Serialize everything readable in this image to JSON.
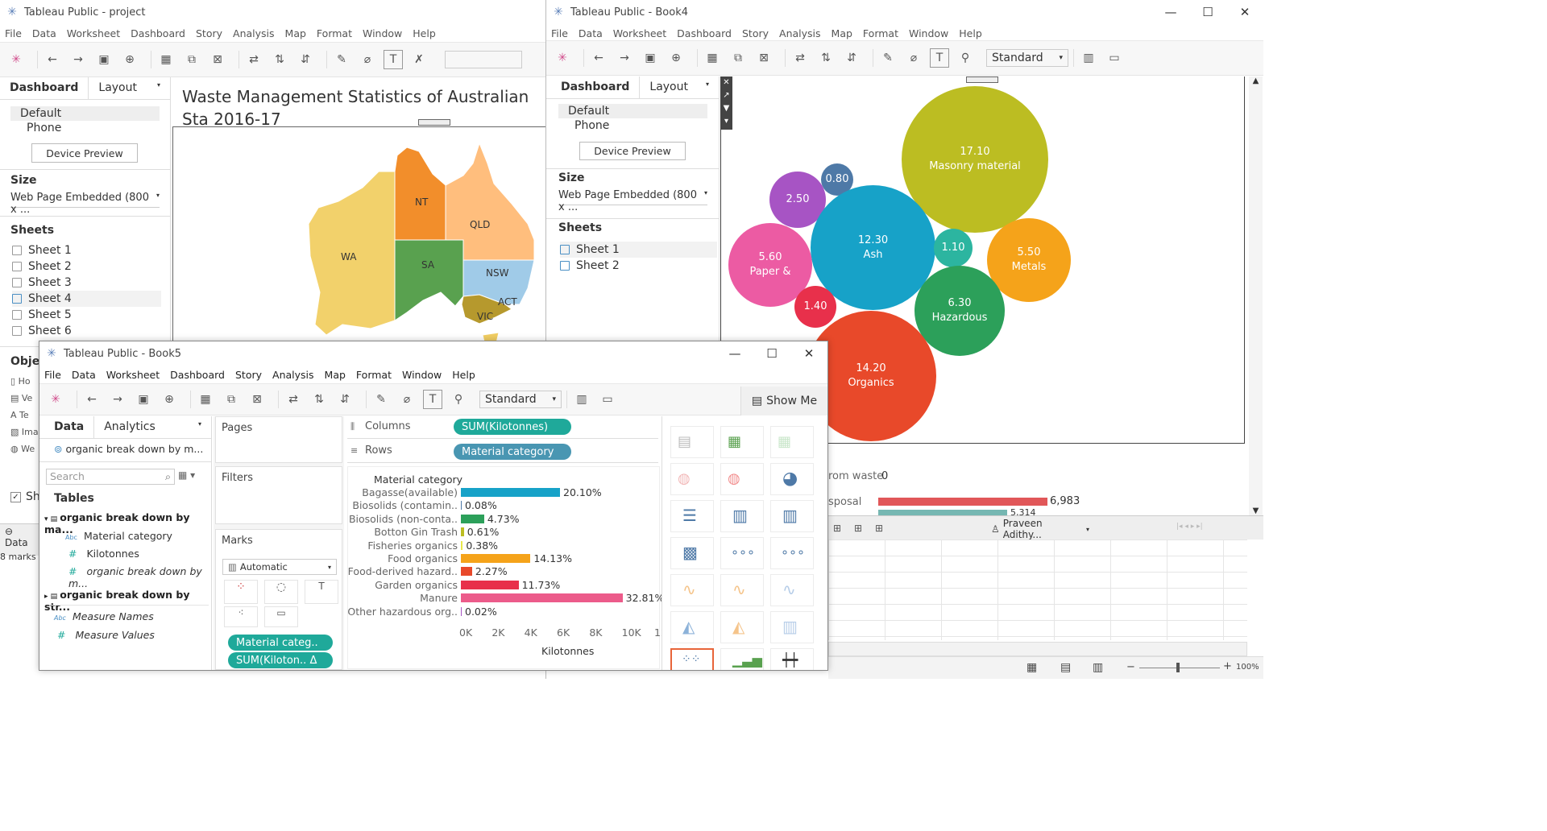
{
  "win_project": {
    "title": "Tableau Public - project",
    "menu": [
      "File",
      "Data",
      "Worksheet",
      "Dashboard",
      "Story",
      "Analysis",
      "Map",
      "Format",
      "Window",
      "Help"
    ],
    "tabs": {
      "dashboard": "Dashboard",
      "layout": "Layout"
    },
    "device_options": [
      "Default",
      "Phone"
    ],
    "device_preview": "Device Preview",
    "size_label": "Size",
    "size_value": "Web Page Embedded (800 x ...",
    "sheets_label": "Sheets",
    "sheets": [
      "Sheet 1",
      "Sheet 2",
      "Sheet 3",
      "Sheet 4",
      "Sheet 5",
      "Sheet 6"
    ],
    "objects_label": "Obje",
    "objects": [
      "Ho",
      "Ve",
      "Te",
      "Ima",
      "We"
    ],
    "show_title_label": "Sh",
    "dashboard_title": "Waste Management Statistics of Australian Sta 2016-17",
    "map_states": [
      "WA",
      "NT",
      "SA",
      "QLD",
      "NSW",
      "VIC",
      "ACT"
    ],
    "status_tab": "Data",
    "status_marks": "8 marks"
  },
  "win_book4": {
    "title": "Tableau Public - Book4",
    "menu": [
      "File",
      "Data",
      "Worksheet",
      "Dashboard",
      "Story",
      "Analysis",
      "Map",
      "Format",
      "Window",
      "Help"
    ],
    "standard": "Standard",
    "tabs": {
      "dashboard": "Dashboard",
      "layout": "Layout"
    },
    "device_options": [
      "Default",
      "Phone"
    ],
    "device_preview": "Device Preview",
    "size_label": "Size",
    "size_value": "Web Page Embedded (800 x ...",
    "sheets_label": "Sheets",
    "sheets": [
      "Sheet 1",
      "Sheet 2"
    ],
    "bubbles": [
      {
        "value": "17.10",
        "label": "Masonry material",
        "color": "#bcbd22"
      },
      {
        "value": "0.80",
        "label": "",
        "color": "#4e79a7"
      },
      {
        "value": "2.50",
        "label": "",
        "color": "#a754c4"
      },
      {
        "value": "12.30",
        "label": "Ash",
        "color": "#17a2c8"
      },
      {
        "value": "1.10",
        "label": "",
        "color": "#2cb5a0"
      },
      {
        "value": "5.50",
        "label": "Metals",
        "color": "#f5a31a"
      },
      {
        "value": "5.60",
        "label": "Paper &",
        "color": "#ec5ba3"
      },
      {
        "value": "6.30",
        "label": "Hazardous",
        "color": "#2ca05a"
      },
      {
        "value": "1.40",
        "label": "",
        "color": "#e8304b"
      },
      {
        "value": "14.20",
        "label": "Organics",
        "color": "#e8492a"
      }
    ],
    "under_label_1": "rom waste",
    "under_value_1": "0",
    "under_label_2": "sposal",
    "under_value_2": "6,983",
    "under_value_3": "5,314",
    "user": "Praveen Adithy...",
    "zoom": "100%"
  },
  "win_book5": {
    "title": "Tableau Public - Book5",
    "menu": [
      "File",
      "Data",
      "Worksheet",
      "Dashboard",
      "Story",
      "Analysis",
      "Map",
      "Format",
      "Window",
      "Help"
    ],
    "standard": "Standard",
    "show_me": "Show Me",
    "tabs": {
      "data": "Data",
      "analytics": "Analytics"
    },
    "datasource": "organic break down by m...",
    "search_placeholder": "Search",
    "tables_label": "Tables",
    "table1": "organic break down by ma...",
    "fields": [
      "Material category",
      "Kilotonnes",
      "organic break down by m..."
    ],
    "table2": "organic break down by str...",
    "measure_names": "Measure Names",
    "measure_values": "Measure Values",
    "pages_label": "Pages",
    "filters_label": "Filters",
    "marks_label": "Marks",
    "marks_type": "Automatic",
    "mark_pill_1": "Material categ..",
    "mark_pill_2": "SUM(Kiloton.. Δ",
    "columns_label": "Columns",
    "rows_label": "Rows",
    "columns_pill": "SUM(Kilotonnes)",
    "rows_pill": "Material category"
  },
  "chart_data": {
    "type": "bar",
    "title": "",
    "ylabel": "Material category",
    "xlabel": "Kilotonnes",
    "xlim": [
      0,
      12000
    ],
    "xticks": [
      "0K",
      "2K",
      "4K",
      "6K",
      "8K",
      "10K",
      "12"
    ],
    "categories": [
      "Bagasse(available)",
      "Biosolids (contamin..",
      "Biosolids (non-conta..",
      "Botton Gin Trash",
      "Fisheries organics",
      "Food organics",
      "Food-derived hazard..",
      "Garden organics",
      "Manure",
      "Other hazardous org.."
    ],
    "values": [
      6100,
      25,
      1430,
      185,
      115,
      4280,
      690,
      3550,
      9950,
      6
    ],
    "labels": [
      "20.10%",
      "0.08%",
      "4.73%",
      "0.61%",
      "0.38%",
      "14.13%",
      "2.27%",
      "11.73%",
      "32.81%",
      "0.02%"
    ],
    "colors": [
      "#17a2c8",
      "#4e79a7",
      "#2ca05a",
      "#bcbd22",
      "#e8e84a",
      "#f5a31a",
      "#e8492a",
      "#e8304b",
      "#ec5b8a",
      "#a754c4"
    ]
  }
}
